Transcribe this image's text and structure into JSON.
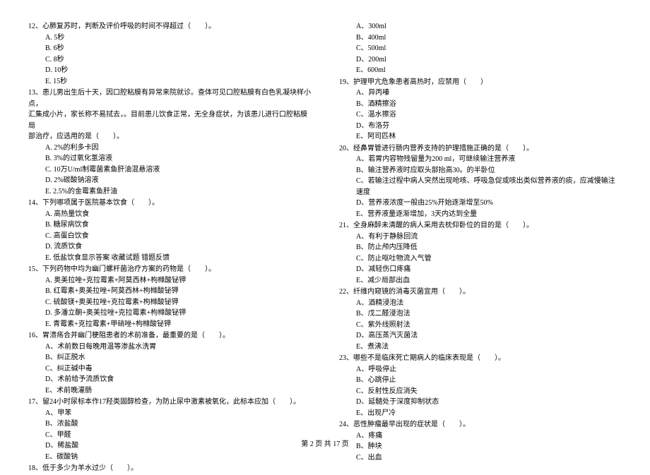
{
  "left": {
    "q12": {
      "stem": "12、心肺复苏时，判断及评价呼吸的时间不得超过（　　）。",
      "opts": [
        "A. 5秒",
        "B. 6秒",
        "C. 8秒",
        "D. 10秒",
        "E. 15秒"
      ]
    },
    "q13": {
      "stem1": "13、患儿男出生后十天，因口腔粘膜有异常来院就诊。查体可见口腔粘膜有白色乳凝块样小点，",
      "stem2": "汇集成小片，家长称不易拭去，。目前患儿饮食正常，无全身症状，为该患儿进行口腔粘膜局",
      "stem3": "部治疗，应选用的是（　　）。",
      "opts": [
        "A. 2%的利多卡因",
        "B. 3%的过氧化氢溶液",
        "C. 10万U/ml制霉菌素鱼肝油混悬溶液",
        "D. 2%碳酸钠溶液",
        "E. 2.5%的金霉素鱼肝油"
      ]
    },
    "q14": {
      "stem": "14、下列哪项属于医院基本饮食（　　）。",
      "opts": [
        "A. 高热量饮食",
        "B. 糖尿病饮食",
        "C. 高蛋白饮食",
        "D. 流质饮食",
        "E. 低盐饮食显示答案  收藏试题  错题反馈"
      ]
    },
    "q15": {
      "stem": "15、下列药物中均为幽门螺杆菌治疗方案的药物是（　　）。",
      "opts": [
        "A. 奥美拉唑+克拉霉素+阿莫西林+枸橼酸铋钾",
        "B. 红霉素+奥美拉唑+阿莫西林+枸橼酸铋钾",
        "C. 硫酸镁+奥美拉唑+克拉霉素+枸橼酸铋钾",
        "D. 多潘立酮+奥美拉唑+克拉霉素+枸橼酸铋钾",
        "E. 青霉素+克拉霉素+甲硝唑+枸橼酸铋钾"
      ]
    },
    "q16": {
      "stem": "16、胃溃疡合并幽门梗阻患者的术前准备，最重要的是（　　）。",
      "opts": [
        "A、术前数日每晚用温等渗盐水洗胃",
        "B、纠正脱水",
        "C、纠正碱中毒",
        "D、术前给予流质饮食",
        "E、术前晚灌肠"
      ]
    },
    "q17": {
      "stem": "17、留24小时尿标本作17羟类固醇检查，为防止尿中激素被氧化，此标本应加（　　）。",
      "opts": [
        "A、甲苯",
        "B、浓盐酸",
        "C、甲醛",
        "D、稀盐酸",
        "E、碳酸钠"
      ]
    },
    "q18": {
      "stem": "18、低于多少为羊水过少（　　）。"
    }
  },
  "right": {
    "q18opts": [
      "A、300ml",
      "B、400ml",
      "C、500ml",
      "D、200ml",
      "E、600ml"
    ],
    "q19": {
      "stem": "19、护理甲亢危象患者高热时，应禁用（　　）",
      "opts": [
        "A、异丙嗪",
        "B、酒精擦浴",
        "C、温水擦浴",
        "D、布洛芬",
        "E、阿司匹林"
      ]
    },
    "q20": {
      "stem": "20、经鼻胃管进行肠内营养支持的护理措施正确的是（　　）。",
      "opts": [
        "A、若胃内容物残留量为200 ml，可继续输注营养液",
        "B、输注营养液时应取头部抬高30。的半卧位",
        "C、若输注过程中病人突然出现呛咳、呼吸急促或咳出类似营养液的痰，应减慢输注速度",
        "D、营养液浓度一般由25%开始逐渐增至50%",
        "E、营养液量逐渐增加，3天内达到全量"
      ]
    },
    "q21": {
      "stem": "21、全身麻醉未清醒的病人采用去枕仰卧位的目的是（　　）。",
      "opts": [
        "A、有利于静脉回流",
        "B、防止颅内压降低",
        "C、防止呕吐物流入气管",
        "D、减轻伤口疼痛",
        "E、减少局部出血"
      ]
    },
    "q22": {
      "stem": "22、纤维内窥镜的消毒灭菌宜用（　　）。",
      "opts": [
        "A、酒精浸泡法",
        "B、戊二醛浸泡法",
        "C、紫外线照射法",
        "D、高压蒸汽灭菌法",
        "E、煮沸法"
      ]
    },
    "q23": {
      "stem": "23、哪些不是临床死亡期病人的临床表现是（　　）。",
      "opts": [
        "A、呼吸停止",
        "B、心跳停止",
        "C、反射性反应消失",
        "D、延髓处于深度抑制状态",
        "E、出现尸冷"
      ]
    },
    "q24": {
      "stem": "24、恶性肿瘤最早出现的症状是（　　）。",
      "opts": [
        "A、疼痛",
        "B、肿块",
        "C、出血"
      ]
    }
  },
  "footer": "第 2 页 共 17 页"
}
